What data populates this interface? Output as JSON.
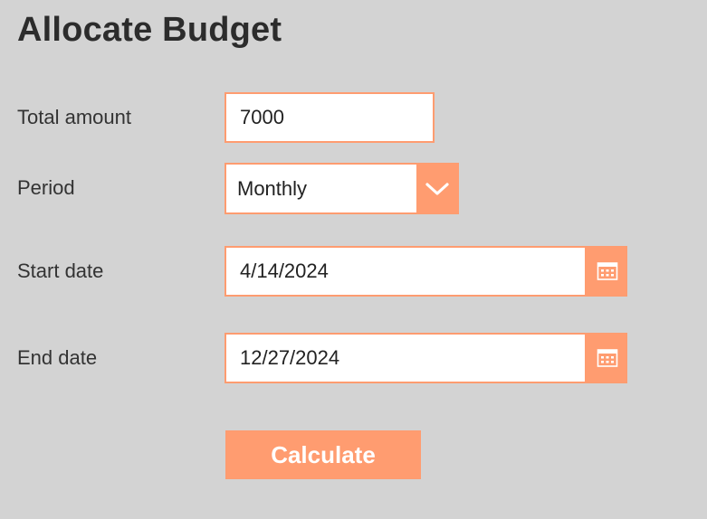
{
  "page": {
    "title": "Allocate Budget"
  },
  "form": {
    "total_amount": {
      "label": "Total amount",
      "value": "7000"
    },
    "period": {
      "label": "Period",
      "value": "Monthly",
      "icon": "chevron-down-icon"
    },
    "start_date": {
      "label": "Start date",
      "value": "4/14/2024",
      "icon": "calendar-icon"
    },
    "end_date": {
      "label": "End date",
      "value": "12/27/2024",
      "icon": "calendar-icon"
    }
  },
  "actions": {
    "calculate_label": "Calculate"
  },
  "colors": {
    "background": "#d3d3d3",
    "accent": "#ff9c70",
    "field_background": "#ffffff",
    "text": "#333333",
    "button_text": "#ffffff"
  }
}
